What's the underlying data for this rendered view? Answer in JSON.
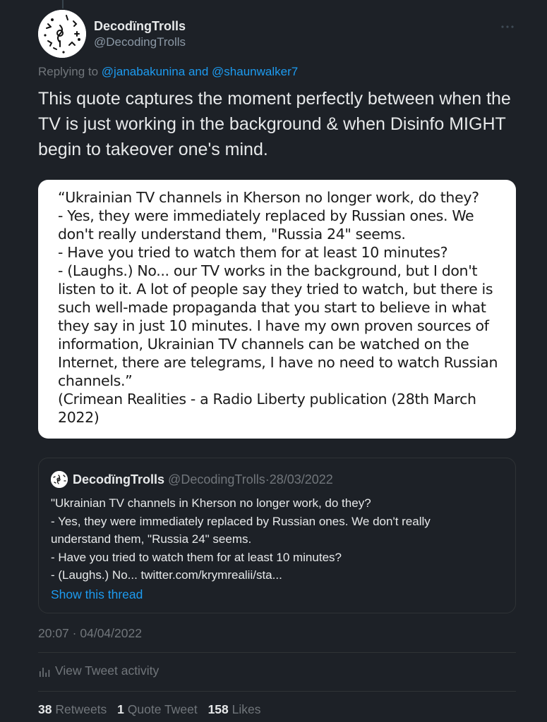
{
  "author": {
    "name": "DecodïngTrolls",
    "handle": "@DecodingTrolls"
  },
  "reply": {
    "prefix": "Replying to",
    "mention1": "@janabakunina",
    "joiner": "and",
    "mention2": "@shaunwalker7"
  },
  "tweet": {
    "text": "This quote captures the moment perfectly between when the TV is just working in the background & when Disinfo MIGHT begin to takeover one's mind."
  },
  "quote_image": {
    "lines": [
      "“Ukrainian TV channels in Kherson no longer work, do they?",
      "- Yes, they were immediately replaced by Russian ones. We",
      "don't really understand them, \"Russia 24\" seems.",
      "- Have you tried to watch them for at least 10 minutes?",
      "- (Laughs.) No... our TV works in the background, but I don't",
      "listen to it. A lot of people say they tried to watch, but there is",
      "such well-made propaganda that you start to believe in what",
      "they say in just 10 minutes. I have my own proven sources of",
      "information, Ukrainian TV channels can be watched on the",
      "Internet, there are telegrams, I have no need to watch Russian",
      "channels.”",
      "(Crimean Realities - a Radio Liberty publication (28th March",
      "2022)"
    ]
  },
  "quoted_tweet": {
    "name": "DecodïngTrolls",
    "handle": "@DecodingTrolls",
    "separator": "·",
    "date": "28/03/2022",
    "lines": [
      "\"Ukrainian TV channels in Kherson no longer work, do they?",
      "- Yes, they were immediately replaced by Russian ones. We don't really",
      "understand them, \"Russia 24\" seems.",
      "- Have you tried to watch them for at least 10 minutes?",
      "- (Laughs.) No... twitter.com/krymrealii/sta..."
    ],
    "show_thread": "Show this thread"
  },
  "meta": {
    "time": "20:07",
    "separator": "·",
    "date": "04/04/2022",
    "activity_label": "View Tweet activity"
  },
  "stats": {
    "retweets_count": "38",
    "retweets_label": "Retweets",
    "quotes_count": "1",
    "quotes_label": "Quote Tweet",
    "likes_count": "158",
    "likes_label": "Likes"
  },
  "icons": {
    "more": "more-dots-icon",
    "activity": "bar-chart-icon"
  },
  "colors": {
    "background": "#1d2127",
    "accent": "#1d9bf0",
    "secondary_text": "#71767b",
    "primary_text": "#e7e9ea"
  }
}
